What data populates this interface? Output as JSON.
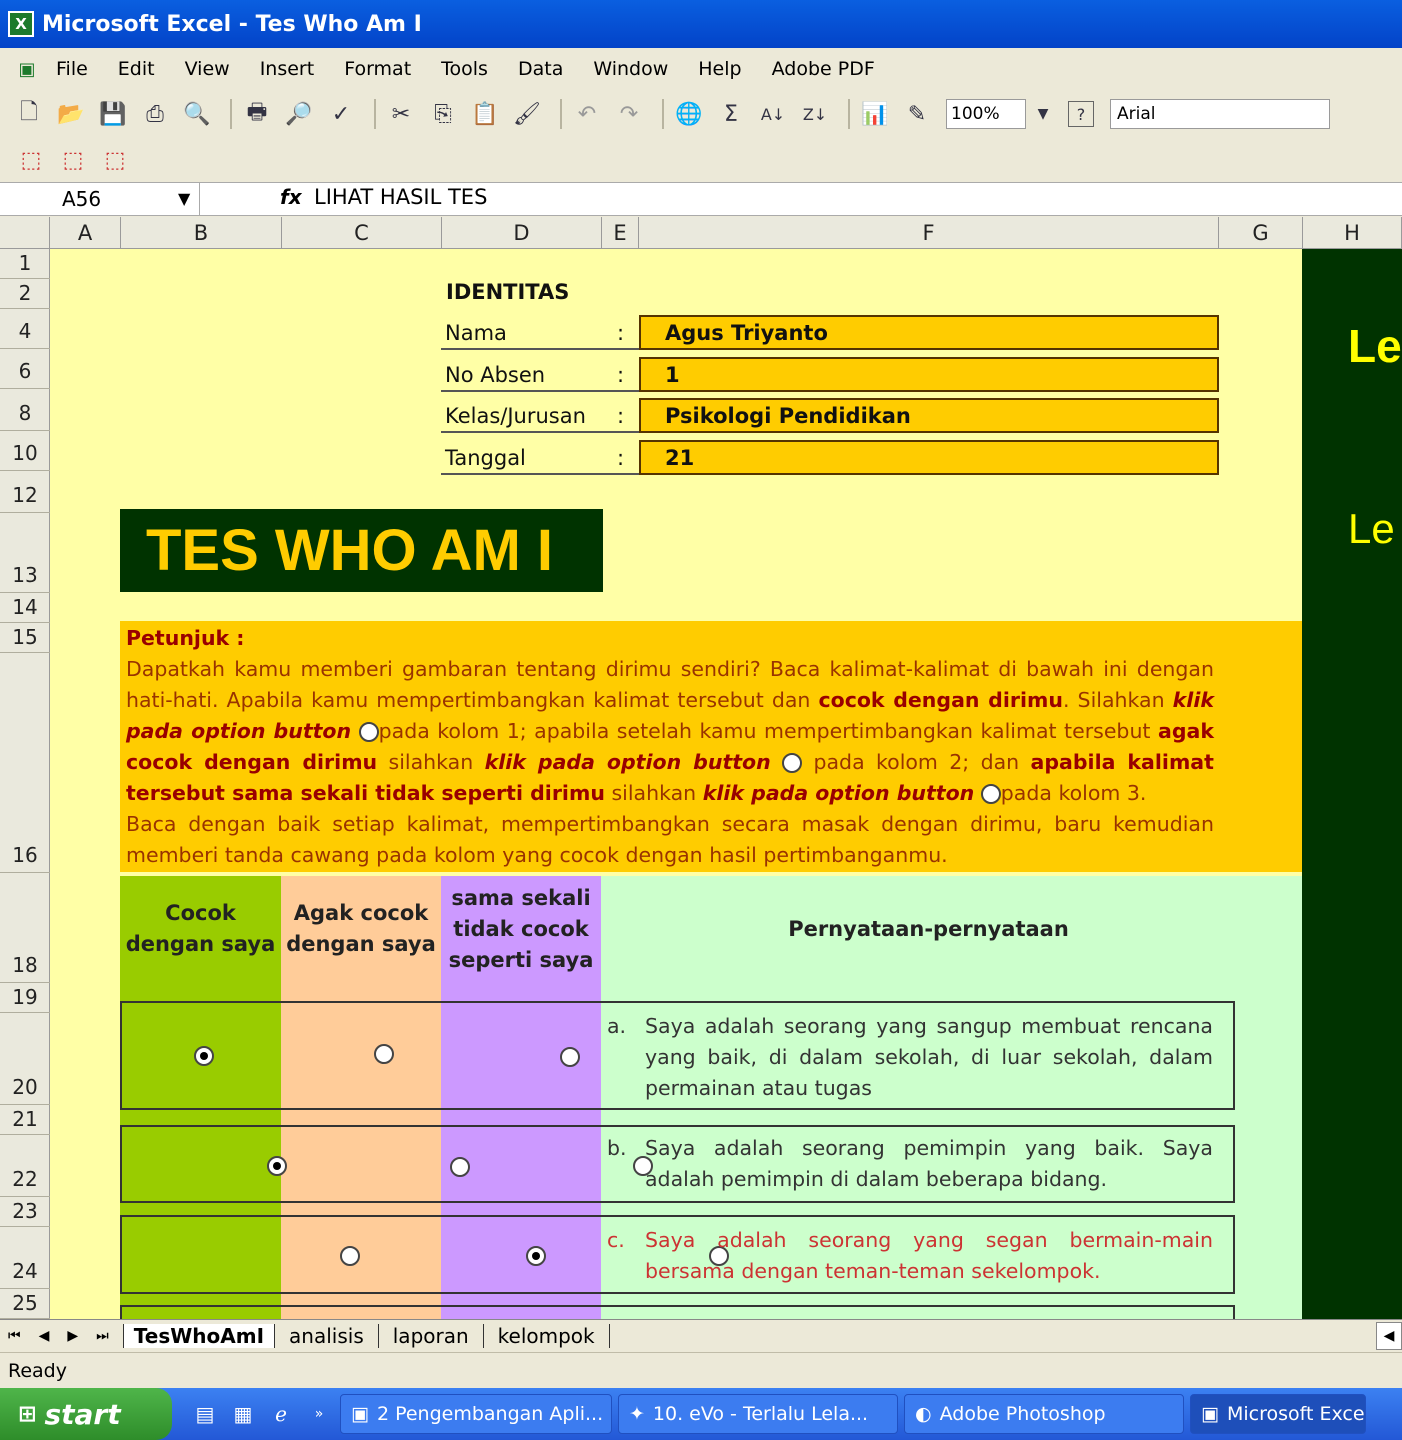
{
  "window": {
    "title": "Microsoft Excel - Tes Who Am I"
  },
  "menu": [
    "File",
    "Edit",
    "View",
    "Insert",
    "Format",
    "Tools",
    "Data",
    "Window",
    "Help",
    "Adobe PDF"
  ],
  "toolbar": {
    "zoom": "100%",
    "font": "Arial",
    "help_icon": "?"
  },
  "formula_bar": {
    "name_box": "A56",
    "fx_label": "fx",
    "content": "LIHAT HASIL TES"
  },
  "columns": [
    "A",
    "B",
    "C",
    "D",
    "E",
    "F",
    "G",
    "H"
  ],
  "rows": [
    "1",
    "2",
    "4",
    "6",
    "8",
    "10",
    "12",
    "13",
    "14",
    "15",
    "16",
    "18",
    "19",
    "20",
    "21",
    "22",
    "23",
    "24",
    "25"
  ],
  "identitas": {
    "heading": "IDENTITAS",
    "fields": [
      {
        "label": "Nama",
        "sep": ":",
        "value": "Agus Triyanto"
      },
      {
        "label": "No Absen",
        "sep": ":",
        "value": "1"
      },
      {
        "label": "Kelas/Jurusan",
        "sep": ":",
        "value": "Psikologi Pendidikan"
      },
      {
        "label": "Tanggal",
        "sep": ":",
        "value": "21"
      }
    ]
  },
  "side_text": {
    "line1": "Le",
    "line2": "Le"
  },
  "title": "TES WHO AM I",
  "petunjuk": {
    "heading": "Petunjuk :",
    "p1": "Dapatkah kamu memberi gambaran tentang dirimu sendiri? Baca kalimat-kalimat di bawah ini dengan hati-hati. Apabila kamu mempertimbangkan kalimat tersebut dan",
    "p1b": "cocok dengan dirimu",
    "p1c": ". Silahkan",
    "k1": "klik pada option button",
    "p2": "pada kolom 1; apabila setelah kamu mempertimbangkan kalimat tersebut",
    "p2b": "agak cocok dengan dirimu",
    "p2c": "silahkan",
    "k2": "klik pada option button",
    "p3": "pada kolom 2; dan",
    "p3b": "apabila kalimat tersebut sama sekali tidak seperti dirimu",
    "p3c": "silahkan",
    "k3": "klik pada option button",
    "p4": "pada kolom 3.",
    "p5": "Baca dengan baik setiap kalimat, mempertimbangkan secara masak dengan dirimu, baru kemudian memberi tanda cawang pada kolom yang cocok dengan hasil pertimbanganmu."
  },
  "table_headers": {
    "col1": "Cocok dengan saya",
    "col2": "Agak cocok dengan saya",
    "col3": "sama sekali tidak cocok seperti saya",
    "col4": "Pernyataan-pernyataan"
  },
  "statements": [
    {
      "letter": "a.",
      "text": "Saya adalah seorang yang sangup membuat rencana yang baik, di dalam sekolah, di luar sekolah, dalam permainan atau tugas",
      "selected": 1,
      "color": "#333333"
    },
    {
      "letter": "b.",
      "text": "Saya adalah seorang pemimpin yang baik. Saya adalah pemimpin di dalam beberapa bidang.",
      "selected": 1,
      "color": "#333333"
    },
    {
      "letter": "c.",
      "text": "Saya adalah seorang yang segan bermain-main bersama dengan teman-teman sekelompok.",
      "selected": 2,
      "color": "#cc3333"
    }
  ],
  "sheet_tabs": [
    "TesWhoAmI",
    "analisis",
    "laporan",
    "kelompok"
  ],
  "status": "Ready",
  "taskbar": {
    "start": "start",
    "items": [
      "2 Pengembangan Apli...",
      "10. eVo - Terlalu Lela...",
      "Adobe Photoshop",
      "Microsoft Exce"
    ]
  }
}
